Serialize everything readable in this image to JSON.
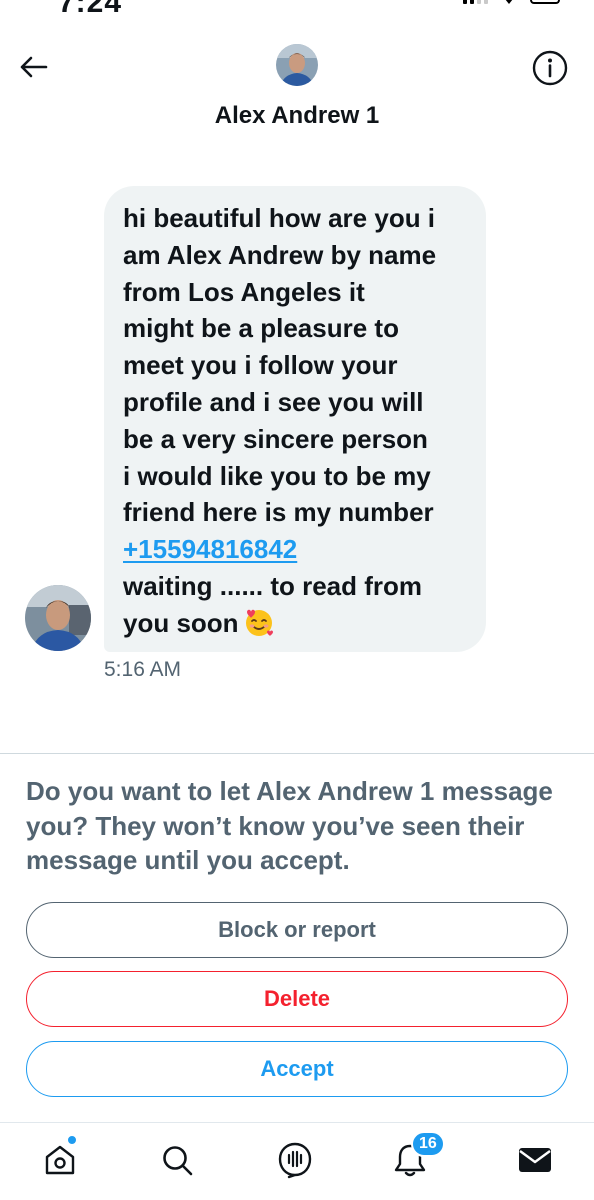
{
  "status_bar": {
    "time": "7:24"
  },
  "header": {
    "contact_name": "Alex Andrew 1"
  },
  "message": {
    "lines_before_link": [
      "hi beautiful how are you i",
      "am Alex Andrew by name",
      "from Los Angeles it",
      "might be a pleasure to",
      "meet you i follow your",
      "profile and i see you will",
      "be a very sincere person",
      "i would like you to be my",
      "friend here is my number"
    ],
    "phone_link": "+15594816842",
    "line_after_link": "waiting ...... to read from",
    "last_line": "you soon",
    "emoji": "smiling-face-with-hearts",
    "time": "5:16 AM"
  },
  "request": {
    "prompt": "Do you want to let Alex Andrew 1 message you? They won’t know you’ve seen their message until you accept."
  },
  "buttons": {
    "block_report": "Block or report",
    "delete": "Delete",
    "accept": "Accept"
  },
  "tabbar": {
    "items": [
      {
        "name": "home",
        "icon": "home-icon",
        "has_dot": true
      },
      {
        "name": "search",
        "icon": "search-icon"
      },
      {
        "name": "spaces",
        "icon": "spaces-icon"
      },
      {
        "name": "notifications",
        "icon": "bell-icon"
      },
      {
        "name": "messages",
        "icon": "envelope-icon",
        "active": true
      }
    ],
    "notifications_count": "16"
  },
  "colors": {
    "accent": "#1d9bf0",
    "danger": "#f4212e",
    "muted": "#536471",
    "bubble": "#eff3f4",
    "text": "#0f1419"
  }
}
